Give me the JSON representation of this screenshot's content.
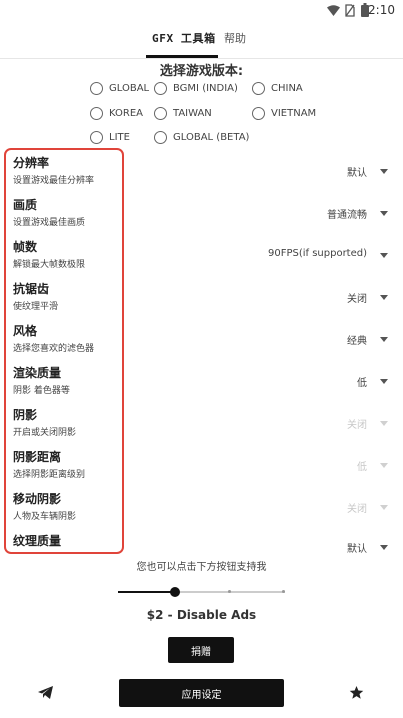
{
  "status_bar": {
    "time": "2:10",
    "icons": [
      "wifi-icon",
      "no-sim-icon",
      "battery-icon"
    ]
  },
  "tabs": {
    "active": "GFX 工具箱",
    "help": "帮助"
  },
  "version_section": {
    "title": "选择游戏版本:",
    "options": [
      "GLOBAL",
      "BGMI (INDIA)",
      "CHINA",
      "KOREA",
      "TAIWAN",
      "VIETNAM",
      "LITE",
      "GLOBAL (BETA)"
    ]
  },
  "settings": [
    {
      "label": "分辨率",
      "desc": "设置游戏最佳分辨率",
      "value": "默认",
      "disabled": false
    },
    {
      "label": "画质",
      "desc": "设置游戏最佳画质",
      "value": "普通流畅",
      "disabled": false
    },
    {
      "label": "帧数",
      "desc": "解锁最大帧数极限",
      "value": "90FPS(if supported)",
      "disabled": false
    },
    {
      "label": "抗锯齿",
      "desc": "使纹理平滑",
      "value": "关闭",
      "disabled": false
    },
    {
      "label": "风格",
      "desc": "选择您喜欢的滤色器",
      "value": "经典",
      "disabled": false
    },
    {
      "label": "渲染质量",
      "desc": "阴影 着色器等",
      "value": "低",
      "disabled": false
    },
    {
      "label": "阴影",
      "desc": "开启或关闭阴影",
      "value": "关闭",
      "disabled": true
    },
    {
      "label": "阴影距离",
      "desc": "选择阴影距离级别",
      "value": "低",
      "disabled": true
    },
    {
      "label": "移动阴影",
      "desc": "人物及车辆阴影",
      "value": "关闭",
      "disabled": true
    },
    {
      "label": "纹理质量",
      "desc": "",
      "value": "默认",
      "disabled": false
    }
  ],
  "support": {
    "text": "您也可以点击下方按钮支持我",
    "price_label": "$2 - Disable Ads",
    "donate_label": "捐赠",
    "slider_level": 0.33
  },
  "bottom": {
    "apply_label": "应用设定",
    "left_icon": "telegram-icon",
    "right_icon": "star-icon"
  },
  "colors": {
    "highlight_border": "#e0443a",
    "button_bg": "#111111"
  }
}
